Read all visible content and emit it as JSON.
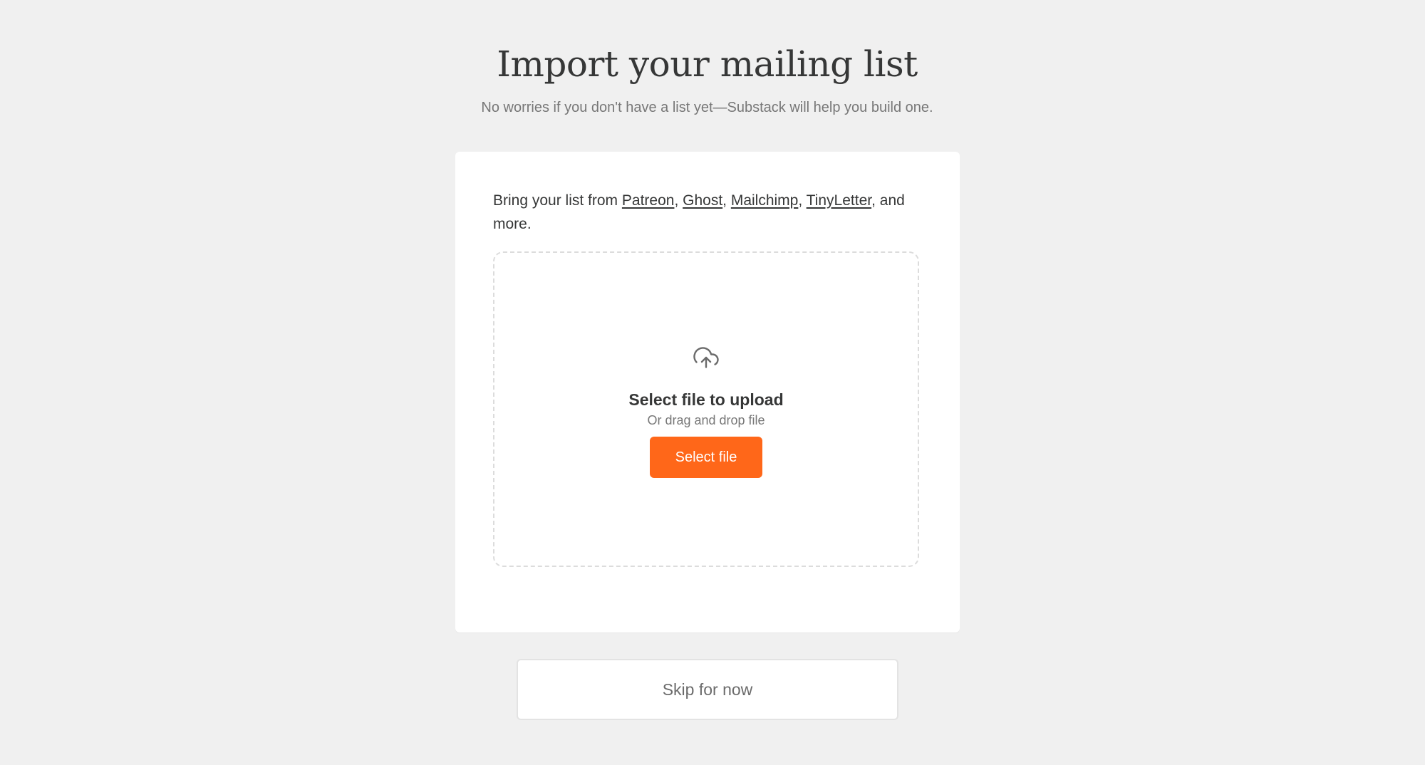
{
  "header": {
    "title": "Import your mailing list",
    "subtitle": "No worries if you don't have a list yet—Substack will help you build one."
  },
  "card": {
    "intro_prefix": "Bring your list from ",
    "links": [
      "Patreon",
      "Ghost",
      "Mailchimp",
      "TinyLetter"
    ],
    "separator": ", ",
    "intro_suffix": ", and more."
  },
  "dropzone": {
    "icon": "cloud-upload-icon",
    "heading": "Select file to upload",
    "subtext": "Or drag and drop file",
    "button_label": "Select file"
  },
  "footer": {
    "skip_label": "Skip for now"
  },
  "colors": {
    "accent": "#ff6719",
    "background": "#f0f0f0",
    "text": "#363737",
    "muted": "#777777"
  }
}
